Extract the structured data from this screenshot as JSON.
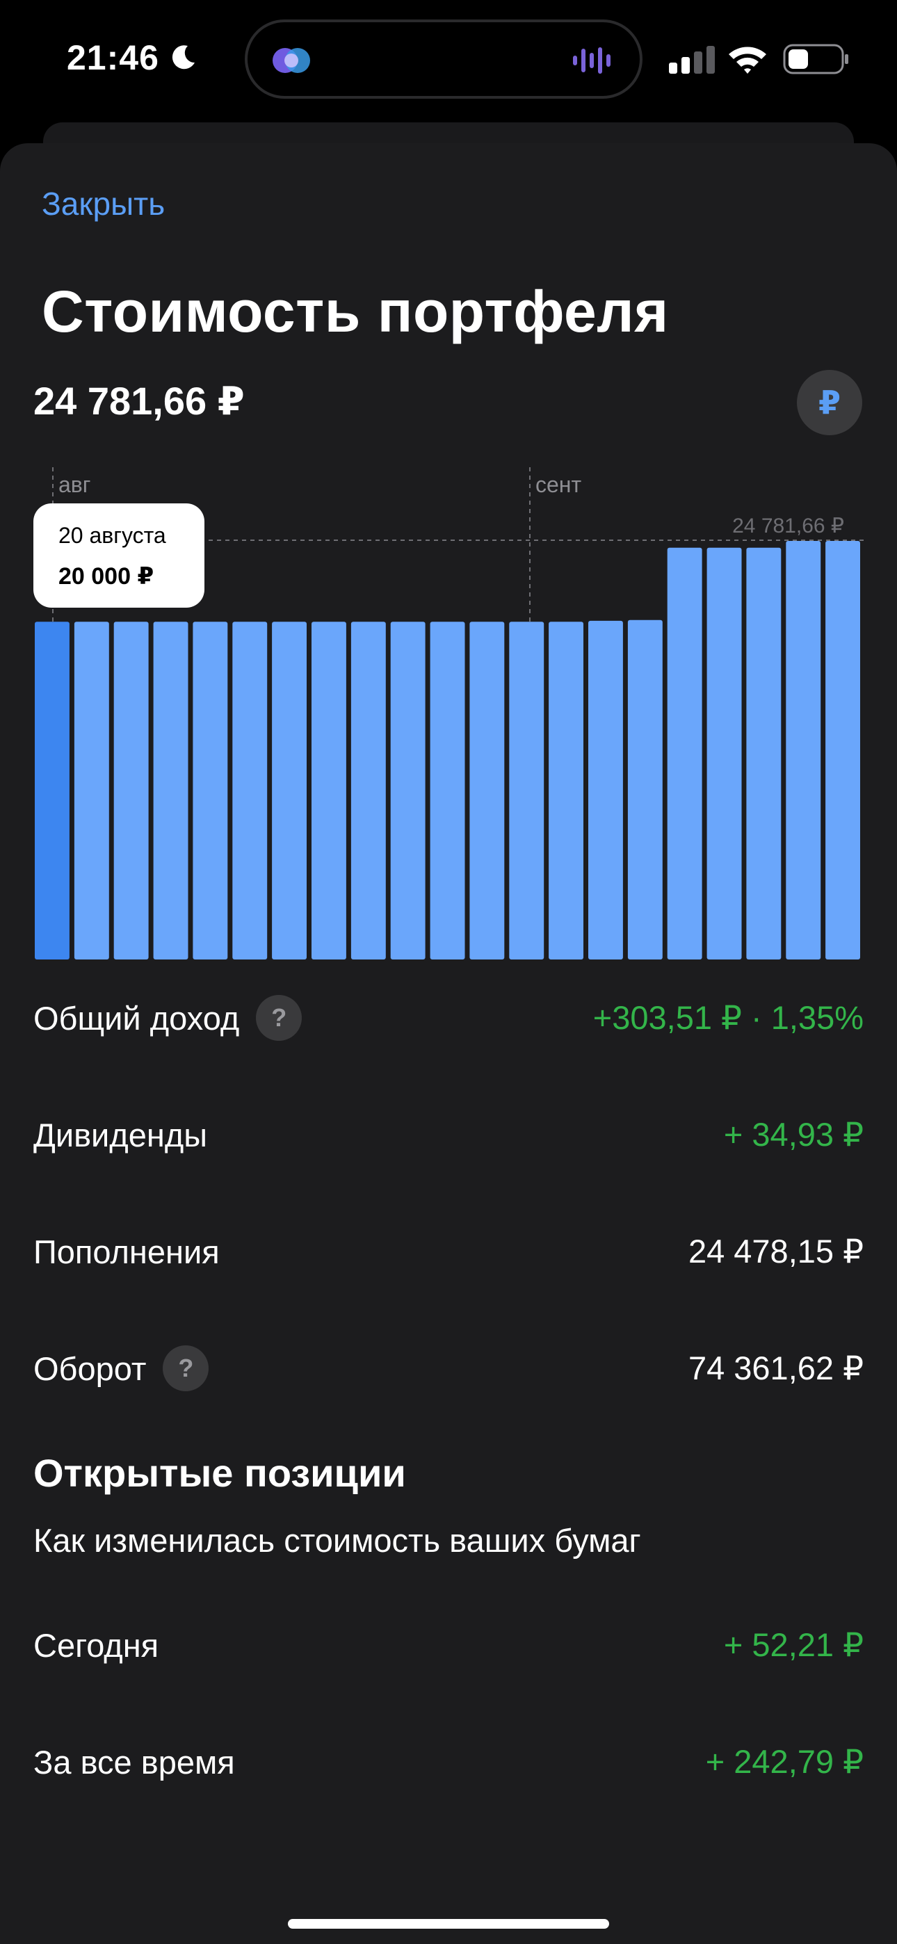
{
  "status_bar": {
    "time": "21:46"
  },
  "header": {
    "close_label": "Закрыть",
    "title": "Стоимость портфеля",
    "total_value": "24 781,66 ₽",
    "currency_symbol": "₽"
  },
  "tooltip": {
    "date": "20 августа",
    "value": "20 000 ₽"
  },
  "chart_data": {
    "type": "bar",
    "month_labels": [
      "авг",
      "сент"
    ],
    "max_label": "24 781,66 ₽",
    "values": [
      20000,
      20000,
      20000,
      20000,
      20000,
      20000,
      20000,
      20000,
      20000,
      20000,
      20000,
      20000,
      20000,
      20000,
      20050,
      20100,
      24380,
      24380,
      24380,
      24781.66,
      24781.66
    ],
    "selected_index": 0,
    "bar_color": "#6aa6fb",
    "selected_color": "#3d86f0"
  },
  "stats": [
    {
      "label": "Общий доход",
      "value": "+303,51 ₽ · 1,35%",
      "positive": true,
      "help": true
    },
    {
      "label": "Дивиденды",
      "value": "+ 34,93 ₽",
      "positive": true,
      "help": false
    },
    {
      "label": "Пополнения",
      "value": "24 478,15 ₽",
      "positive": false,
      "help": false
    },
    {
      "label": "Оборот",
      "value": "74 361,62 ₽",
      "positive": false,
      "help": true
    }
  ],
  "positions": {
    "title": "Открытые позиции",
    "subtitle": "Как изменилась стоимость ваших бумаг",
    "rows": [
      {
        "label": "Сегодня",
        "value": "+ 52,21 ₽"
      },
      {
        "label": "За все время",
        "value": "+ 242,79 ₽"
      }
    ]
  },
  "colors": {
    "accent": "#5b9ef5",
    "positive": "#33b54a",
    "background": "#1c1c1e"
  }
}
